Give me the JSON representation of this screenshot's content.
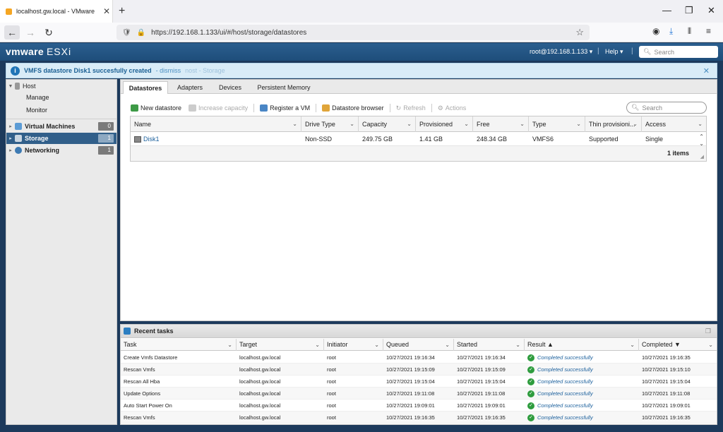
{
  "browser": {
    "tab_title": "localhost.gw.local - VMware ESXi",
    "new_tab": "+",
    "url": "https://192.168.1.133/ui/#/host/storage/datastores"
  },
  "header": {
    "logo_brand": "vmware",
    "logo_product": "ESXi",
    "user": "root@192.168.1.133 ▾",
    "help": "Help ▾",
    "search_placeholder": "Search"
  },
  "notification": {
    "message": "VMFS datastore Disk1 succesfully created",
    "dismiss": "- dismiss",
    "ghost": "nost - Storage"
  },
  "sidebar": {
    "host": "Host",
    "manage": "Manage",
    "monitor": "Monitor",
    "vms": "Virtual Machines",
    "vms_count": "0",
    "storage": "Storage",
    "storage_count": "1",
    "networking": "Networking",
    "networking_count": "1"
  },
  "tabs": [
    "Datastores",
    "Adapters",
    "Devices",
    "Persistent Memory"
  ],
  "toolbar": {
    "new_datastore": "New datastore",
    "increase_capacity": "Increase capacity",
    "register_vm": "Register a VM",
    "datastore_browser": "Datastore browser",
    "refresh": "Refresh",
    "actions": "Actions",
    "search_placeholder": "Search"
  },
  "grid": {
    "columns": [
      "Name",
      "Drive Type",
      "Capacity",
      "Provisioned",
      "Free",
      "Type",
      "Thin provisioni...",
      "Access"
    ],
    "rows": [
      [
        "Disk1",
        "Non-SSD",
        "249.75 GB",
        "1.41 GB",
        "248.34 GB",
        "VMFS6",
        "Supported",
        "Single"
      ]
    ],
    "count": "1 items"
  },
  "tasks": {
    "title": "Recent tasks",
    "columns": [
      "Task",
      "Target",
      "Initiator",
      "Queued",
      "Started",
      "Result ▲",
      "Completed ▼"
    ],
    "rows": [
      [
        "Create Vmfs Datastore",
        "localhost.gw.local",
        "root",
        "10/27/2021 19:16:34",
        "10/27/2021 19:16:34",
        "Completed successfully",
        "10/27/2021 19:16:35"
      ],
      [
        "Rescan Vmfs",
        "localhost.gw.local",
        "root",
        "10/27/2021 19:15:09",
        "10/27/2021 19:15:09",
        "Completed successfully",
        "10/27/2021 19:15:10"
      ],
      [
        "Rescan All Hba",
        "localhost.gw.local",
        "root",
        "10/27/2021 19:15:04",
        "10/27/2021 19:15:04",
        "Completed successfully",
        "10/27/2021 19:15:04"
      ],
      [
        "Update Options",
        "localhost.gw.local",
        "root",
        "10/27/2021 19:11:08",
        "10/27/2021 19:11:08",
        "Completed successfully",
        "10/27/2021 19:11:08"
      ],
      [
        "Auto Start Power On",
        "localhost.gw.local",
        "root",
        "10/27/2021 19:09:01",
        "10/27/2021 19:09:01",
        "Completed successfully",
        "10/27/2021 19:09:01"
      ],
      [
        "Rescan Vmfs",
        "localhost.gw.local",
        "root",
        "10/27/2021 19:16:35",
        "10/27/2021 19:16:35",
        "Completed successfully",
        "10/27/2021 19:16:35"
      ]
    ]
  },
  "colors": {
    "header_blue": "#1e4d7a",
    "active_nav": "#315f8a",
    "link": "#1a5f9c",
    "success": "#2e9c3e"
  }
}
